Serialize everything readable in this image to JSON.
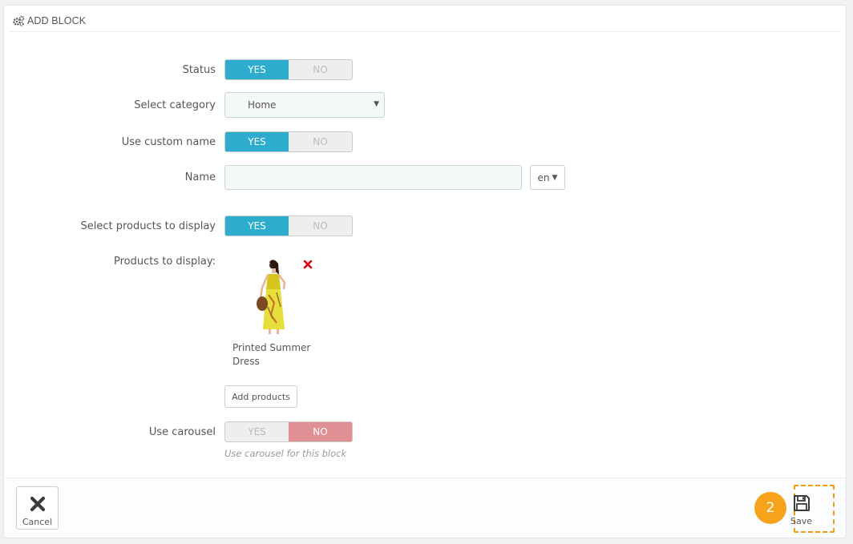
{
  "panel": {
    "title": "ADD BLOCK",
    "title_icon": "gears-icon"
  },
  "form": {
    "status": {
      "label": "Status",
      "yes": "YES",
      "no": "NO",
      "value": "yes"
    },
    "category": {
      "label": "Select category",
      "value": "Home"
    },
    "use_custom_name": {
      "label": "Use custom name",
      "yes": "YES",
      "no": "NO",
      "value": "yes"
    },
    "name": {
      "label": "Name",
      "value": "",
      "language": "en"
    },
    "select_products": {
      "label": "Select products to display",
      "yes": "YES",
      "no": "NO",
      "value": "yes"
    },
    "products": {
      "label": "Products to display:",
      "items": [
        {
          "name": "Printed Summer Dress"
        }
      ],
      "add_button": "Add products"
    },
    "use_carousel": {
      "label": "Use carousel",
      "yes": "YES",
      "no": "NO",
      "value": "no",
      "help": "Use carousel for this block"
    }
  },
  "footer": {
    "cancel_label": "Cancel",
    "save_label": "Save",
    "step_number": "2"
  },
  "colors": {
    "switch_yes": "#2eacce",
    "switch_no": "#e08f95",
    "highlight": "#f39c12",
    "remove": "#e3000f"
  }
}
